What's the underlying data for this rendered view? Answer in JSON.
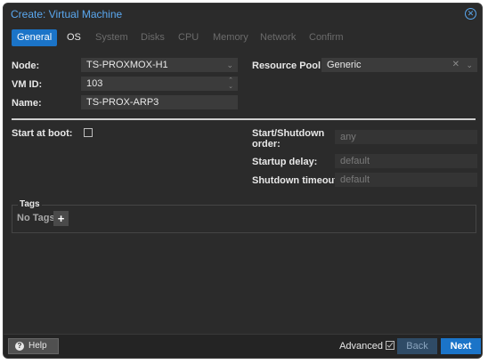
{
  "window": {
    "title": "Create: Virtual Machine"
  },
  "tabs": [
    {
      "label": "General",
      "state": "active"
    },
    {
      "label": "OS",
      "state": "enabled"
    },
    {
      "label": "System",
      "state": "disabled"
    },
    {
      "label": "Disks",
      "state": "disabled"
    },
    {
      "label": "CPU",
      "state": "disabled"
    },
    {
      "label": "Memory",
      "state": "disabled"
    },
    {
      "label": "Network",
      "state": "disabled"
    },
    {
      "label": "Confirm",
      "state": "disabled"
    }
  ],
  "form": {
    "node_label": "Node:",
    "node_value": "TS-PROXMOX-H1",
    "vmid_label": "VM ID:",
    "vmid_value": "103",
    "name_label": "Name:",
    "name_value": "TS-PROX-ARP3",
    "pool_label": "Resource Pool:",
    "pool_value": "Generic",
    "start_at_boot_label": "Start at boot:",
    "start_at_boot_checked": false,
    "shutdown_order_label_line1": "Start/Shutdown",
    "shutdown_order_label_line2": "order:",
    "shutdown_order_placeholder": "any",
    "startup_delay_label": "Startup delay:",
    "startup_delay_placeholder": "default",
    "shutdown_timeout_label": "Shutdown timeout:",
    "shutdown_timeout_placeholder": "default"
  },
  "tags": {
    "legend": "Tags",
    "empty_text": "No Tags",
    "add_symbol": "+"
  },
  "footer": {
    "help_label": "Help",
    "advanced_label": "Advanced",
    "advanced_checked": true,
    "back_label": "Back",
    "next_label": "Next"
  },
  "colors": {
    "accent": "#1b74c8",
    "title": "#5aa8f0",
    "background": "#2b2b2b"
  },
  "icons": {
    "close": "close-circle-icon",
    "dropdown": "chevron-down-icon",
    "spinner": "spinner-arrows-icon",
    "clear": "clear-x-icon",
    "help": "question-icon",
    "add": "plus-icon",
    "check": "checkmark-icon"
  }
}
